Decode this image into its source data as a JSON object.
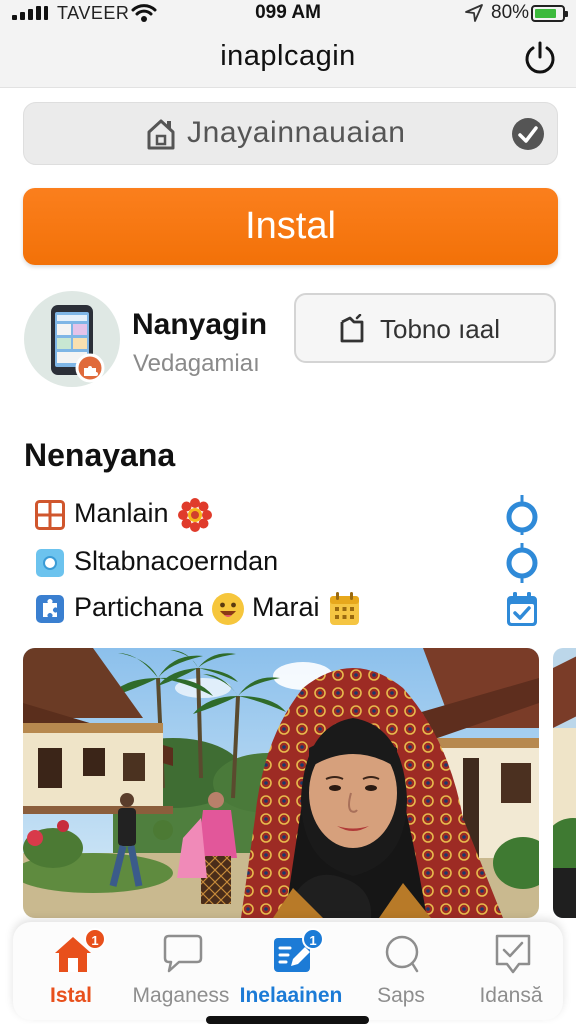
{
  "status_bar": {
    "carrier": "TAVEER",
    "time": "099 AM",
    "battery": "80%",
    "battery_level": 0.8
  },
  "header": {
    "title": "inaplcagin",
    "power_icon": "power-icon"
  },
  "search": {
    "value": "Jnayainnauaian",
    "leading_icon": "home-icon",
    "trailing_icon": "check-circle-icon"
  },
  "install_button": {
    "label": "Instal",
    "color": "#f77a14"
  },
  "app": {
    "name": "Nanyagin",
    "subtitle": "Vedagamiaı",
    "icon": "phone-app-icon",
    "secondary_button": {
      "label": "Tobno ıaal",
      "icon": "tablet-icon"
    }
  },
  "section": {
    "title": "Nenayana",
    "items": [
      {
        "label": "Manlain",
        "icon": "grid-icon",
        "emoji_icon": "red-flower-icon",
        "control": "slider-knob-icon"
      },
      {
        "label": "Sltabnacoerndan",
        "icon": "blue-square-icon",
        "control": "slider-knob-icon"
      },
      {
        "label": "Partichana",
        "label2": "Marai",
        "icon": "puzzle-icon",
        "emoji_icon": "smiley-icon",
        "emoji_icon2": "calendar-icon",
        "control": "calendar-check-icon"
      }
    ]
  },
  "photo": {
    "description_icon": "photo-woman-village"
  },
  "bottom_nav": {
    "items": [
      {
        "label": "Istal",
        "icon": "home-icon",
        "active": true,
        "badge": "1",
        "color": "#e8501c"
      },
      {
        "label": "Maganess",
        "icon": "chat-bubble-icon",
        "active": false
      },
      {
        "label": "Inelaainen",
        "icon": "edit-list-icon",
        "active": true,
        "badge": "1",
        "color": "#1c7bd6"
      },
      {
        "label": "Saps",
        "icon": "search-icon",
        "active": false
      },
      {
        "label": "Idansă",
        "icon": "bookmark-check-icon",
        "active": false
      }
    ]
  }
}
